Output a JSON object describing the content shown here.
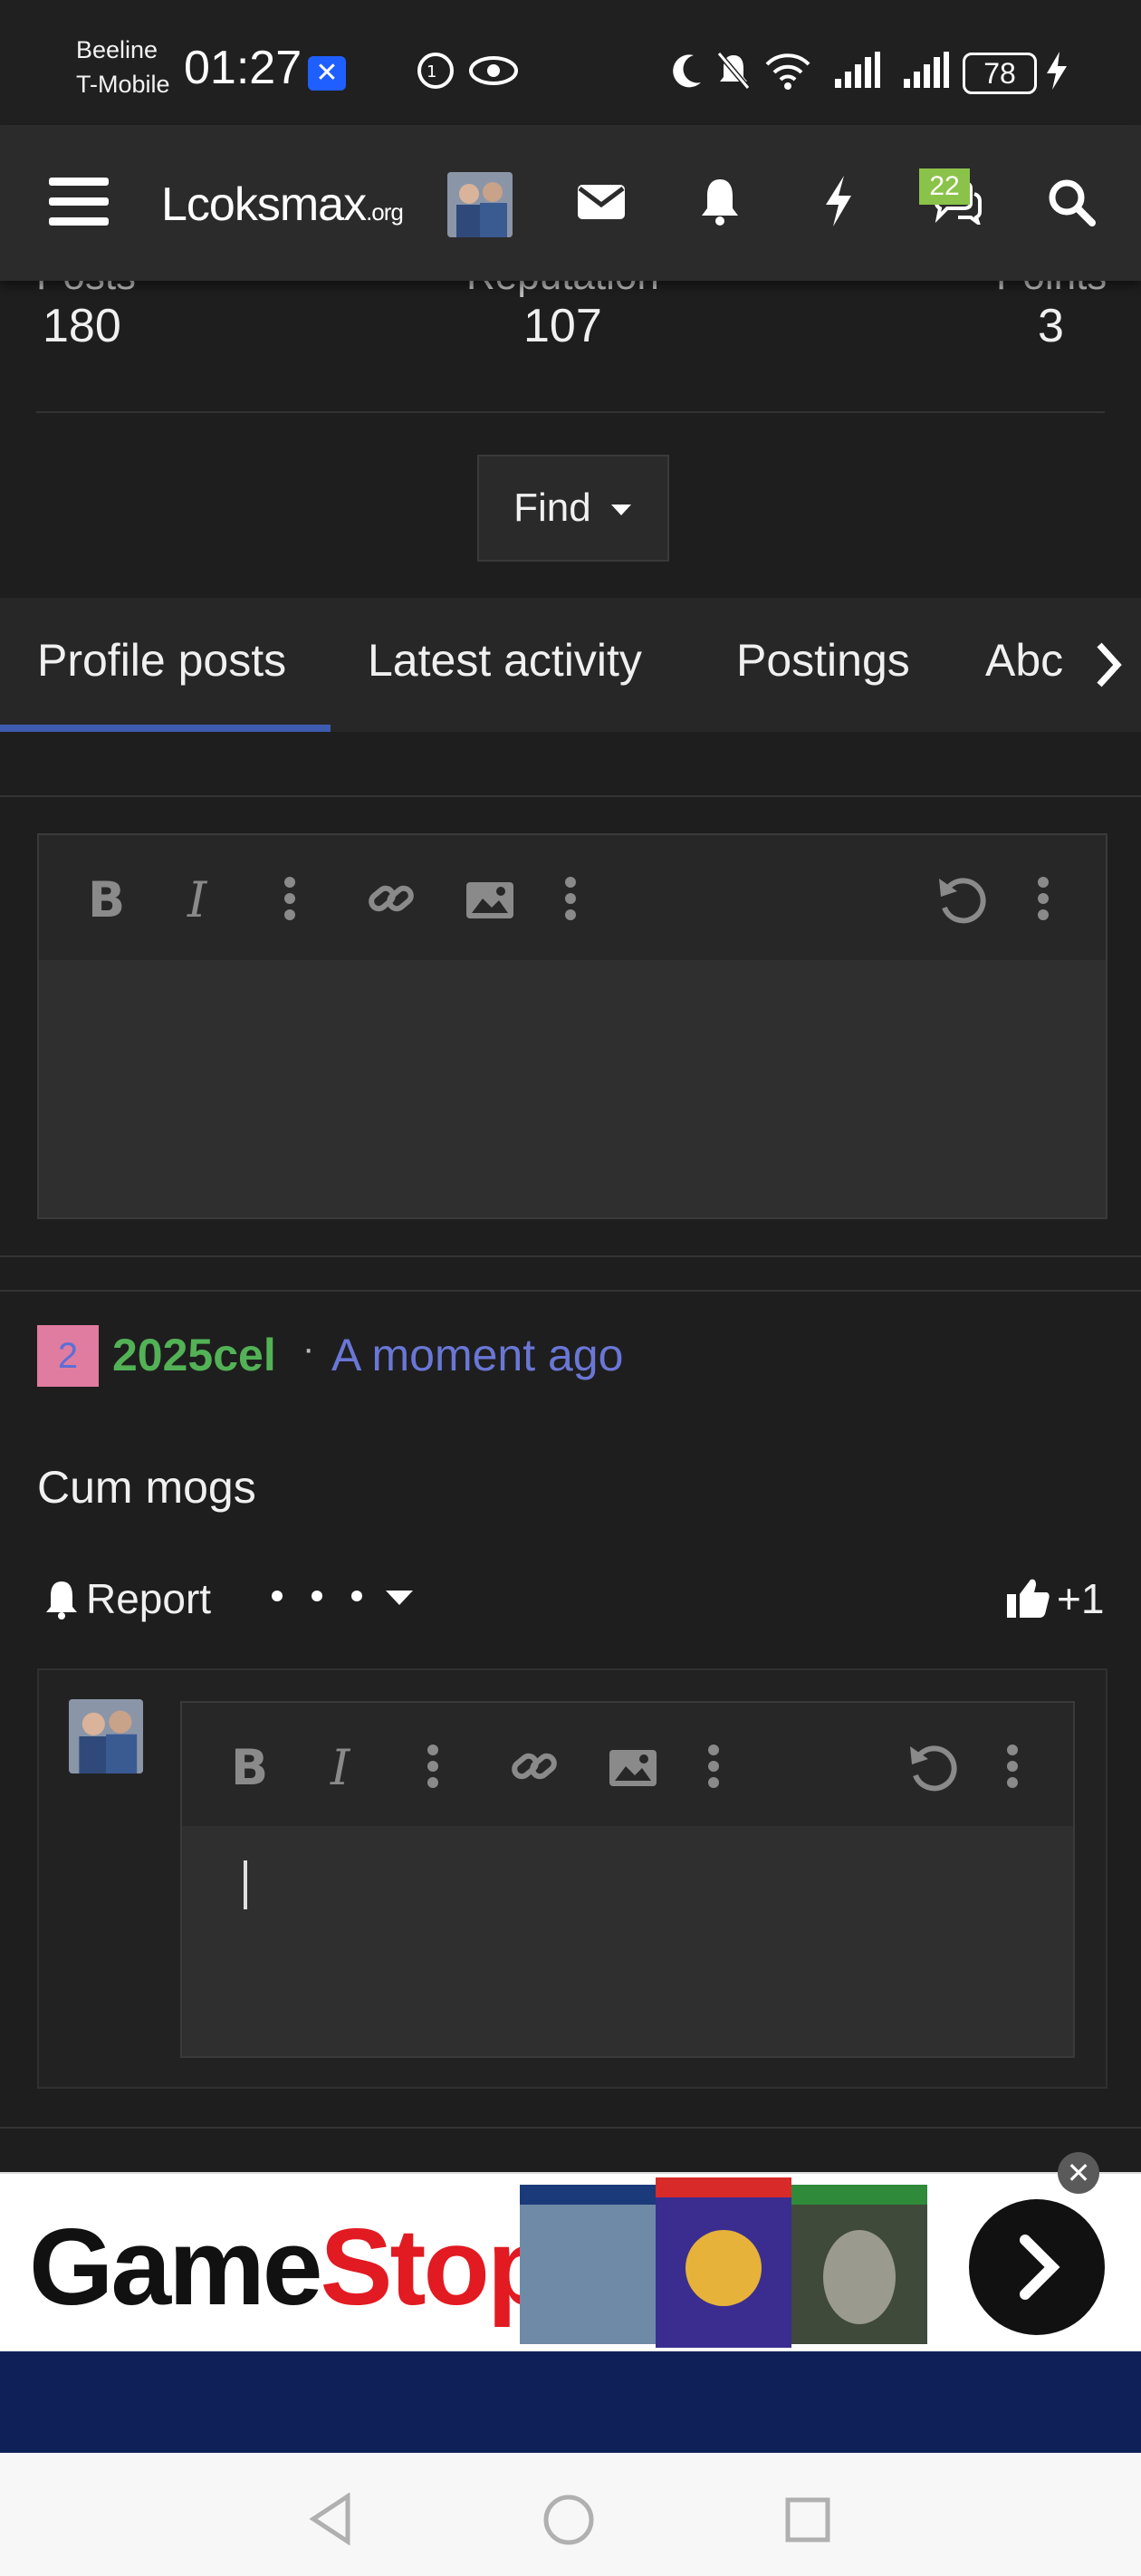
{
  "status_bar": {
    "carrier_1": "Beeline",
    "carrier_2": "T-Mobile",
    "time": "01:27",
    "battery": "78"
  },
  "navbar": {
    "logo": "Lcoksmax",
    "logo_suffix": ".org",
    "conversations_count": "22"
  },
  "stats": {
    "posts_label": "Posts",
    "posts_value": "180",
    "reputation_label": "Reputation",
    "reputation_value": "107",
    "points_label": "Points",
    "points_value": "3"
  },
  "find_label": "Find",
  "tabs": [
    {
      "label": "Profile posts"
    },
    {
      "label": "Latest activity"
    },
    {
      "label": "Postings"
    },
    {
      "label": "Abc"
    }
  ],
  "post": {
    "avatar_letter": "2",
    "author": "2025cel",
    "separator": "·",
    "time": "A moment ago",
    "body": "Cum mogs",
    "report_label": "Report",
    "reaction_count": "+1"
  },
  "ad": {
    "brand_black": "Game",
    "brand_red": "Stop",
    "close_label": "✕"
  },
  "colors": {
    "background": "#1e1e1e",
    "navbar": "#2b2b2b",
    "accent": "#3f5bb0",
    "username": "#52b255",
    "timestamp": "#6a77d6",
    "badge_green": "#8bc34a"
  }
}
